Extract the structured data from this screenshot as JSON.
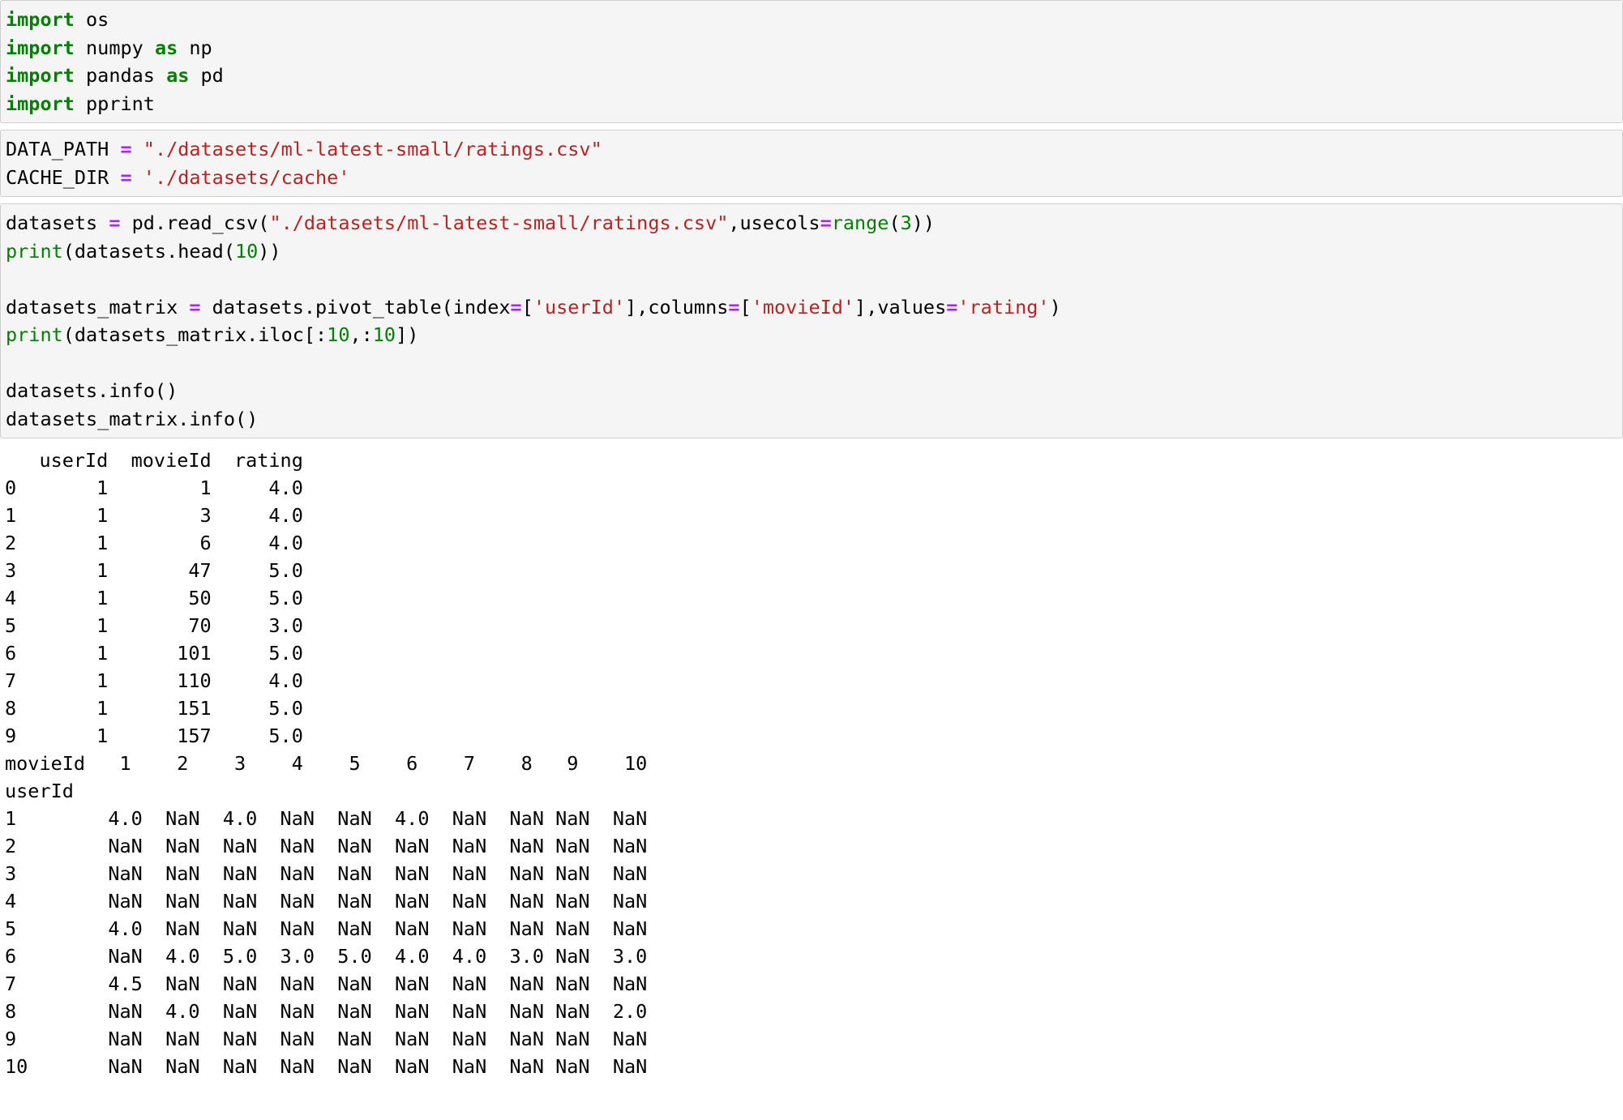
{
  "notebook": {
    "cells": [
      {
        "id": "cell-imports",
        "type": "code",
        "lines": [
          [
            {
              "t": "import",
              "c": "kw"
            },
            {
              "t": " os",
              "c": "pnc"
            }
          ],
          [
            {
              "t": "import",
              "c": "kw"
            },
            {
              "t": " numpy ",
              "c": "pnc"
            },
            {
              "t": "as",
              "c": "kw"
            },
            {
              "t": " np",
              "c": "pnc"
            }
          ],
          [
            {
              "t": "import",
              "c": "kw"
            },
            {
              "t": " pandas ",
              "c": "pnc"
            },
            {
              "t": "as",
              "c": "kw"
            },
            {
              "t": " pd",
              "c": "pnc"
            }
          ],
          [
            {
              "t": "import",
              "c": "kw"
            },
            {
              "t": " pprint",
              "c": "pnc"
            }
          ]
        ],
        "plain": [
          "import os",
          "import numpy as np",
          "import pandas as pd",
          "import pprint"
        ]
      },
      {
        "id": "cell-paths",
        "type": "code",
        "lines": [
          [
            {
              "t": "DATA_PATH ",
              "c": "pnc"
            },
            {
              "t": "=",
              "c": "op"
            },
            {
              "t": " ",
              "c": "pnc"
            },
            {
              "t": "\"./datasets/ml-latest-small/ratings.csv\"",
              "c": "str"
            }
          ],
          [
            {
              "t": "CACHE_DIR ",
              "c": "pnc"
            },
            {
              "t": "=",
              "c": "op"
            },
            {
              "t": " ",
              "c": "pnc"
            },
            {
              "t": "'./datasets/cache'",
              "c": "str"
            }
          ]
        ],
        "plain": [
          "DATA_PATH = \"./datasets/ml-latest-small/ratings.csv\"",
          "CACHE_DIR = './datasets/cache'"
        ]
      },
      {
        "id": "cell-load-pivot",
        "type": "code",
        "lines": [
          [
            {
              "t": "datasets ",
              "c": "pnc"
            },
            {
              "t": "=",
              "c": "op"
            },
            {
              "t": " pd.read_csv(",
              "c": "pnc"
            },
            {
              "t": "\"./datasets/ml-latest-small/ratings.csv\"",
              "c": "str"
            },
            {
              "t": ",usecols",
              "c": "pnc"
            },
            {
              "t": "=",
              "c": "op"
            },
            {
              "t": "range",
              "c": "bi"
            },
            {
              "t": "(",
              "c": "pnc"
            },
            {
              "t": "3",
              "c": "num"
            },
            {
              "t": "))",
              "c": "pnc"
            }
          ],
          [
            {
              "t": "print",
              "c": "bi"
            },
            {
              "t": "(datasets.head(",
              "c": "pnc"
            },
            {
              "t": "10",
              "c": "num"
            },
            {
              "t": "))",
              "c": "pnc"
            }
          ],
          [
            {
              "t": "",
              "c": "pnc"
            }
          ],
          [
            {
              "t": "datasets_matrix ",
              "c": "pnc"
            },
            {
              "t": "=",
              "c": "op"
            },
            {
              "t": " datasets.pivot_table(index",
              "c": "pnc"
            },
            {
              "t": "=",
              "c": "op"
            },
            {
              "t": "[",
              "c": "pnc"
            },
            {
              "t": "'userId'",
              "c": "str"
            },
            {
              "t": "],columns",
              "c": "pnc"
            },
            {
              "t": "=",
              "c": "op"
            },
            {
              "t": "[",
              "c": "pnc"
            },
            {
              "t": "'movieId'",
              "c": "str"
            },
            {
              "t": "],values",
              "c": "pnc"
            },
            {
              "t": "=",
              "c": "op"
            },
            {
              "t": "'rating'",
              "c": "str"
            },
            {
              "t": ")",
              "c": "pnc"
            }
          ],
          [
            {
              "t": "print",
              "c": "bi"
            },
            {
              "t": "(datasets_matrix.iloc[:",
              "c": "pnc"
            },
            {
              "t": "10",
              "c": "num"
            },
            {
              "t": ",:",
              "c": "pnc"
            },
            {
              "t": "10",
              "c": "num"
            },
            {
              "t": "])",
              "c": "pnc"
            }
          ],
          [
            {
              "t": "",
              "c": "pnc"
            }
          ],
          [
            {
              "t": "datasets.info()",
              "c": "pnc"
            }
          ],
          [
            {
              "t": "datasets_matrix.info()",
              "c": "pnc"
            }
          ]
        ],
        "plain": [
          "datasets = pd.read_csv(\"./datasets/ml-latest-small/ratings.csv\",usecols=range(3))",
          "print(datasets.head(10))",
          "",
          "datasets_matrix = datasets.pivot_table(index=['userId'],columns=['movieId'],values='rating')",
          "print(datasets_matrix.iloc[:10,:10])",
          "",
          "datasets.info()",
          "datasets_matrix.info()"
        ]
      }
    ]
  },
  "output": {
    "head_table": {
      "columns": [
        "userId",
        "movieId",
        "rating"
      ],
      "index_label": "",
      "index": [
        "0",
        "1",
        "2",
        "3",
        "4",
        "5",
        "6",
        "7",
        "8",
        "9"
      ],
      "rows": [
        [
          "1",
          "1",
          "4.0"
        ],
        [
          "1",
          "3",
          "4.0"
        ],
        [
          "1",
          "6",
          "4.0"
        ],
        [
          "1",
          "47",
          "5.0"
        ],
        [
          "1",
          "50",
          "5.0"
        ],
        [
          "1",
          "70",
          "3.0"
        ],
        [
          "1",
          "101",
          "5.0"
        ],
        [
          "1",
          "110",
          "4.0"
        ],
        [
          "1",
          "151",
          "5.0"
        ],
        [
          "1",
          "157",
          "5.0"
        ]
      ]
    },
    "pivot_table": {
      "columns_label": "movieId",
      "index_label": "userId",
      "columns": [
        "1",
        "2",
        "3",
        "4",
        "5",
        "6",
        "7",
        "8",
        "9",
        "10"
      ],
      "index": [
        "1",
        "2",
        "3",
        "4",
        "5",
        "6",
        "7",
        "8",
        "9",
        "10"
      ],
      "rows": [
        [
          "4.0",
          "NaN",
          "4.0",
          "NaN",
          "NaN",
          "4.0",
          "NaN",
          "NaN",
          "NaN",
          "NaN"
        ],
        [
          "NaN",
          "NaN",
          "NaN",
          "NaN",
          "NaN",
          "NaN",
          "NaN",
          "NaN",
          "NaN",
          "NaN"
        ],
        [
          "NaN",
          "NaN",
          "NaN",
          "NaN",
          "NaN",
          "NaN",
          "NaN",
          "NaN",
          "NaN",
          "NaN"
        ],
        [
          "NaN",
          "NaN",
          "NaN",
          "NaN",
          "NaN",
          "NaN",
          "NaN",
          "NaN",
          "NaN",
          "NaN"
        ],
        [
          "4.0",
          "NaN",
          "NaN",
          "NaN",
          "NaN",
          "NaN",
          "NaN",
          "NaN",
          "NaN",
          "NaN"
        ],
        [
          "NaN",
          "4.0",
          "5.0",
          "3.0",
          "5.0",
          "4.0",
          "4.0",
          "3.0",
          "NaN",
          "3.0"
        ],
        [
          "4.5",
          "NaN",
          "NaN",
          "NaN",
          "NaN",
          "NaN",
          "NaN",
          "NaN",
          "NaN",
          "NaN"
        ],
        [
          "NaN",
          "4.0",
          "NaN",
          "NaN",
          "NaN",
          "NaN",
          "NaN",
          "NaN",
          "NaN",
          "2.0"
        ],
        [
          "NaN",
          "NaN",
          "NaN",
          "NaN",
          "NaN",
          "NaN",
          "NaN",
          "NaN",
          "NaN",
          "NaN"
        ],
        [
          "NaN",
          "NaN",
          "NaN",
          "NaN",
          "NaN",
          "NaN",
          "NaN",
          "NaN",
          "NaN",
          "NaN"
        ]
      ]
    },
    "head_lines": [
      "   userId  movieId  rating",
      "0       1        1     4.0",
      "1       1        3     4.0",
      "2       1        6     4.0",
      "3       1       47     5.0",
      "4       1       50     5.0",
      "5       1       70     3.0",
      "6       1      101     5.0",
      "7       1      110     4.0",
      "8       1      151     5.0",
      "9       1      157     5.0"
    ],
    "pivot_lines": [
      "movieId   1    2    3    4    5    6    7    8   9    10 ",
      "userId                                                   ",
      "1        4.0  NaN  4.0  NaN  NaN  4.0  NaN  NaN NaN  NaN ",
      "2        NaN  NaN  NaN  NaN  NaN  NaN  NaN  NaN NaN  NaN ",
      "3        NaN  NaN  NaN  NaN  NaN  NaN  NaN  NaN NaN  NaN ",
      "4        NaN  NaN  NaN  NaN  NaN  NaN  NaN  NaN NaN  NaN ",
      "5        4.0  NaN  NaN  NaN  NaN  NaN  NaN  NaN NaN  NaN ",
      "6        NaN  4.0  5.0  3.0  5.0  4.0  4.0  3.0 NaN  3.0 ",
      "7        4.5  NaN  NaN  NaN  NaN  NaN  NaN  NaN NaN  NaN ",
      "8        NaN  4.0  NaN  NaN  NaN  NaN  NaN  NaN NaN  2.0 ",
      "9        NaN  NaN  NaN  NaN  NaN  NaN  NaN  NaN NaN  NaN ",
      "10       NaN  NaN  NaN  NaN  NaN  NaN  NaN  NaN NaN  NaN "
    ]
  },
  "theme": {
    "cell_background": "#f5f5f5",
    "cell_border": "#cfcfcf",
    "output_background": "#ffffff",
    "keyword_color": "#008000",
    "string_color": "#ba2121",
    "operator_color": "#aa22ff",
    "builtin_color": "#008000",
    "number_color": "#008000",
    "text_color": "#000000"
  }
}
